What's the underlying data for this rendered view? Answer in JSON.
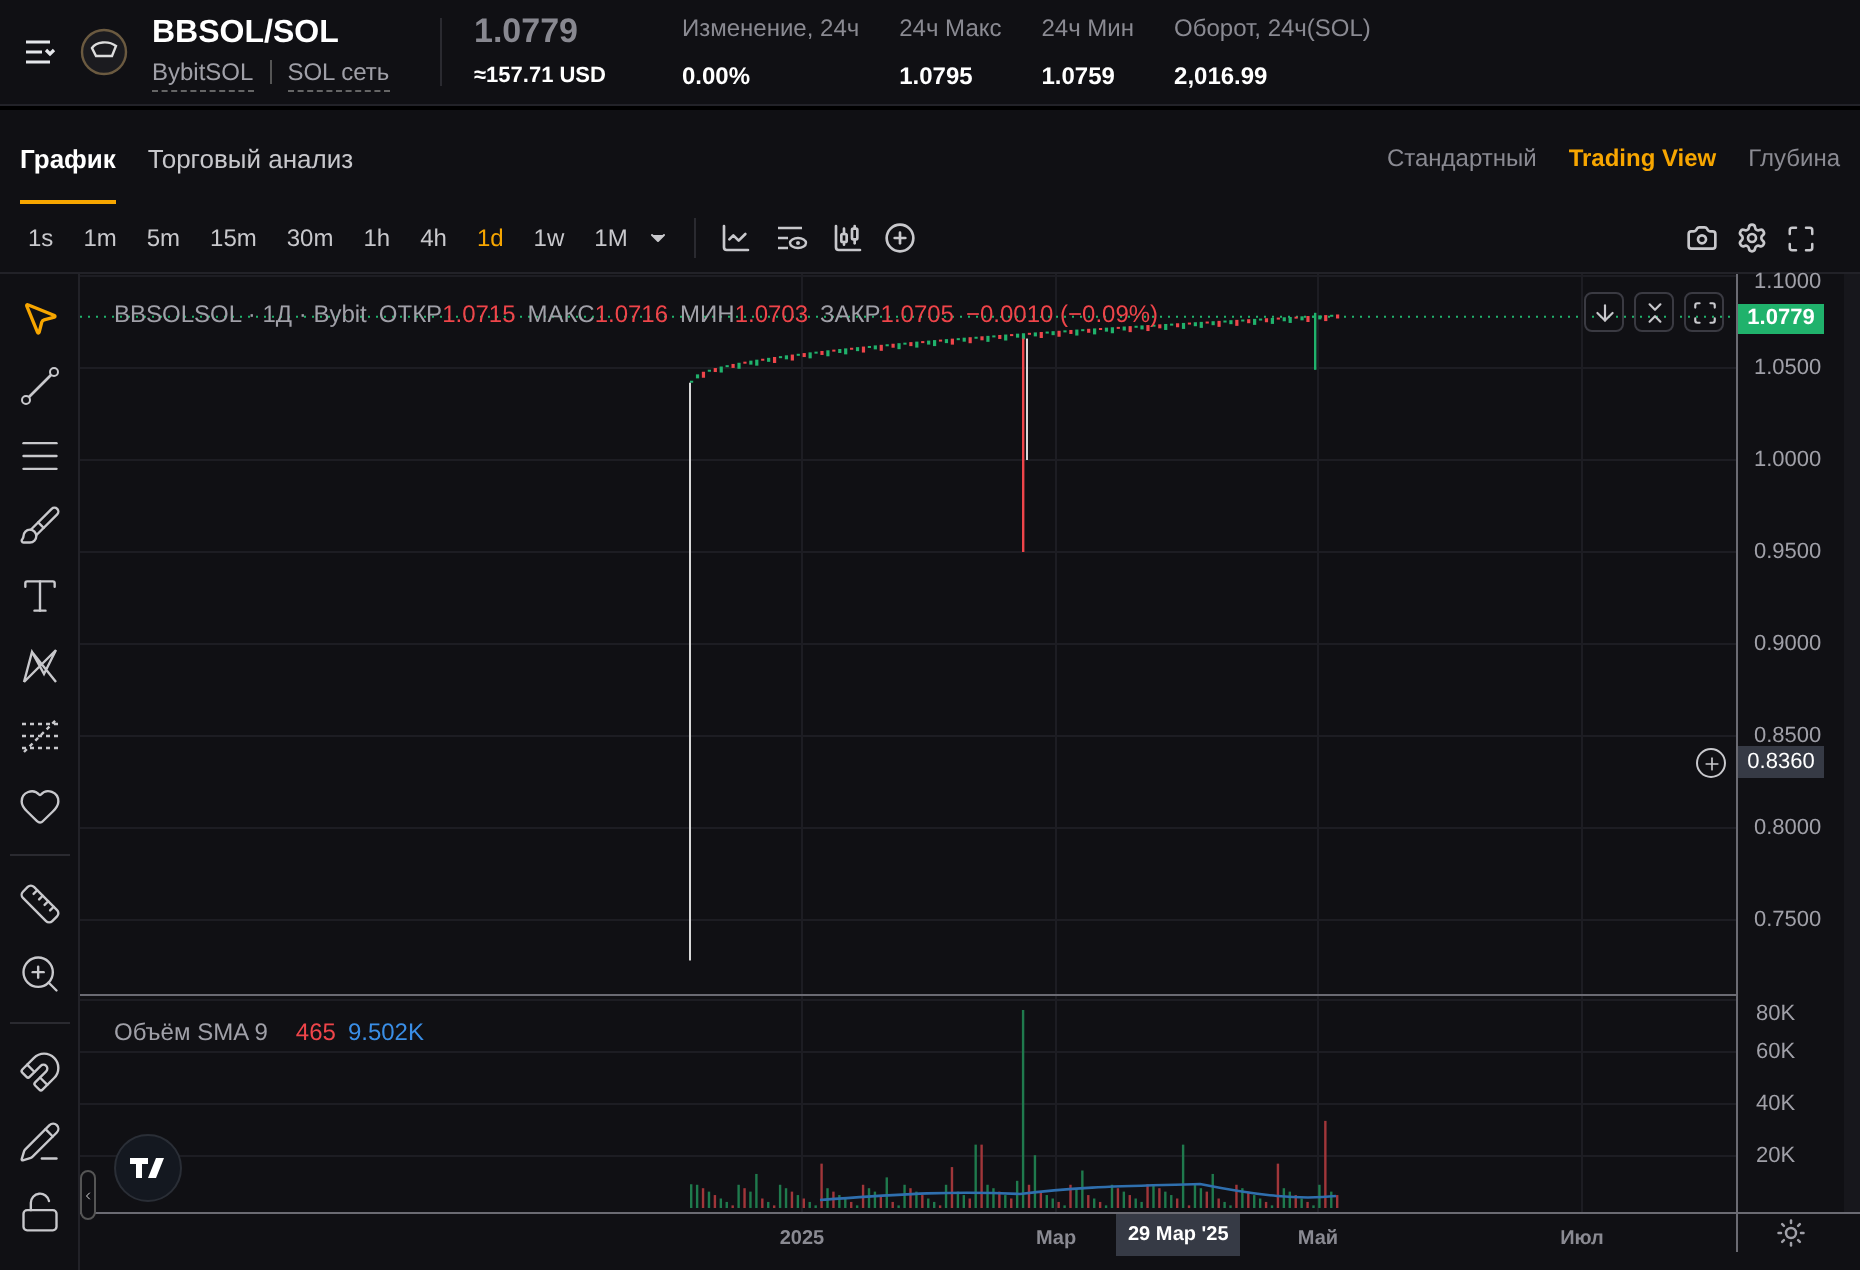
{
  "header": {
    "pair": "BBSOL/SOL",
    "token": "BybitSOL",
    "network": "SOL сеть",
    "price": "1.0779",
    "price_usd": "≈157.71 USD",
    "stats": [
      {
        "label": "Изменение, 24ч",
        "value": "0.00%"
      },
      {
        "label": "24ч Макс",
        "value": "1.0795"
      },
      {
        "label": "24ч Мин",
        "value": "1.0759"
      },
      {
        "label": "Оборот, 24ч(SOL)",
        "value": "2,016.99"
      }
    ]
  },
  "tabs": [
    {
      "label": "График",
      "selected": true
    },
    {
      "label": "Торговый анализ",
      "selected": false
    }
  ],
  "views": [
    {
      "label": "Стандартный",
      "selected": false
    },
    {
      "label": "Trading View",
      "selected": true
    },
    {
      "label": "Глубина",
      "selected": false
    }
  ],
  "intervals": [
    {
      "label": "1s",
      "selected": false
    },
    {
      "label": "1m",
      "selected": false
    },
    {
      "label": "5m",
      "selected": false
    },
    {
      "label": "15m",
      "selected": false
    },
    {
      "label": "30m",
      "selected": false
    },
    {
      "label": "1h",
      "selected": false
    },
    {
      "label": "4h",
      "selected": false
    },
    {
      "label": "1d",
      "selected": true
    },
    {
      "label": "1w",
      "selected": false
    },
    {
      "label": "1M",
      "selected": false
    }
  ],
  "legend": {
    "title": "BBSOLSOL · 1Д · Bybit",
    "values": [
      {
        "label": "ОТКР",
        "value": "1.0715"
      },
      {
        "label": "МАКС",
        "value": "1.0716"
      },
      {
        "label": "МИН",
        "value": "1.0703"
      },
      {
        "label": "ЗАКР",
        "value": "1.0705"
      }
    ],
    "change": "−0.0010 (−0.09%)"
  },
  "price_axis": {
    "ticks": [
      "1.1000",
      "1.0500",
      "1.0000",
      "0.9500",
      "0.9000",
      "0.8500",
      "0.8000",
      "0.7500"
    ],
    "last_price": "1.0779",
    "crosshair_price": "0.8360"
  },
  "volume": {
    "title": "Объём SMA 9",
    "value": "465",
    "sma": "9.502K",
    "ticks": [
      "80K",
      "60K",
      "40K",
      "20K"
    ]
  },
  "time_axis": {
    "labels": [
      "2025",
      "Мар",
      "Май",
      "Июл"
    ],
    "crosshair_date": "29 Мар '25"
  }
}
